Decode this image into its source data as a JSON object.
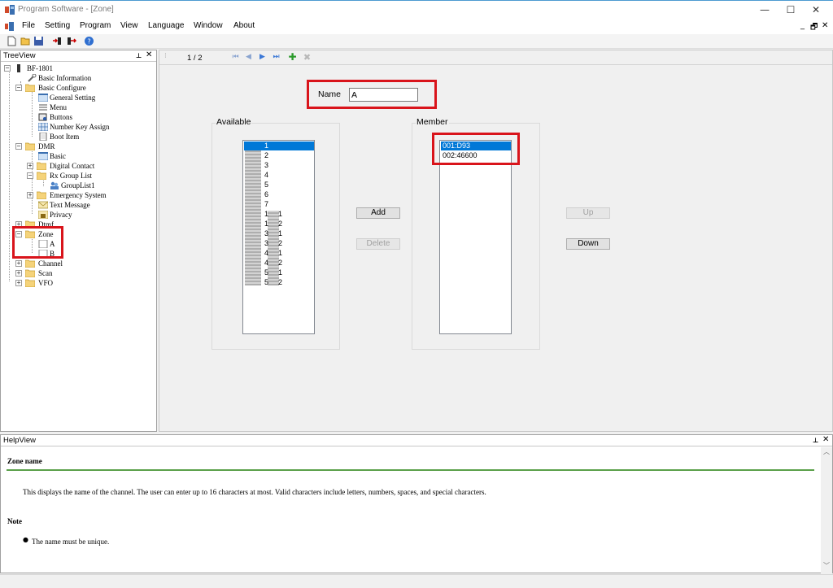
{
  "window": {
    "title": "Program Software - [Zone]",
    "minimize": "—",
    "maximize": "☐",
    "close": "✕"
  },
  "menu": {
    "items": [
      "File",
      "Setting",
      "Program",
      "View",
      "Language",
      "Window",
      "About"
    ],
    "mdi_minimize": "_",
    "mdi_restore": "🗗",
    "mdi_close": "✕"
  },
  "toolbar": {
    "icons": [
      "new-icon",
      "open-icon",
      "save-icon",
      "read-radio-icon",
      "write-radio-icon",
      "help-icon"
    ]
  },
  "treeview": {
    "title": "TreeView",
    "pin": "📌",
    "close": "✕",
    "nodes": [
      {
        "label": "BF-1801",
        "level": 0
      },
      {
        "label": "Basic Information",
        "level": 1
      },
      {
        "label": "Basic Configure",
        "level": 1
      },
      {
        "label": "General Setting",
        "level": 2
      },
      {
        "label": "Menu",
        "level": 2
      },
      {
        "label": "Buttons",
        "level": 2
      },
      {
        "label": "Number Key Assign",
        "level": 2
      },
      {
        "label": "Boot Item",
        "level": 2
      },
      {
        "label": "DMR",
        "level": 1
      },
      {
        "label": "Basic",
        "level": 2
      },
      {
        "label": "Digital Contact",
        "level": 2
      },
      {
        "label": "Rx Group List",
        "level": 2
      },
      {
        "label": "GroupList1",
        "level": 3
      },
      {
        "label": "Emergency System",
        "level": 2
      },
      {
        "label": "Text Message",
        "level": 2
      },
      {
        "label": "Privacy",
        "level": 2
      },
      {
        "label": "Dtmf",
        "level": 1
      },
      {
        "label": "Zone",
        "level": 1
      },
      {
        "label": "A",
        "level": 2
      },
      {
        "label": "B",
        "level": 2
      },
      {
        "label": "Channel",
        "level": 1
      },
      {
        "label": "Scan",
        "level": 1
      },
      {
        "label": "VFO",
        "level": 1
      }
    ]
  },
  "main": {
    "page_indicator": "1 / 2",
    "name_label": "Name",
    "name_value": "A",
    "available_label": "Available",
    "member_label": "Member",
    "available_items": [
      "1",
      "2",
      "3",
      "4",
      "5",
      "6",
      "7",
      "1",
      "1",
      "3",
      "3",
      "4",
      "4",
      "5",
      "5"
    ],
    "available_items_right": [
      "1",
      "2",
      "1",
      "2",
      "1",
      "2",
      "1",
      "2"
    ],
    "member_items": [
      "001:D93",
      "002:46600"
    ],
    "add_button": "Add",
    "delete_button": "Delete",
    "up_button": "Up",
    "down_button": "Down"
  },
  "helpview": {
    "title": "HelpView",
    "pin": "📌",
    "close": "✕",
    "heading": "Zone name",
    "description": "This displays the name of the channel. The user can enter up to 16 characters at most. Valid characters include letters, numbers, spaces, and special characters.",
    "note_heading": "Note",
    "note_bullet": "The name must be unique."
  }
}
